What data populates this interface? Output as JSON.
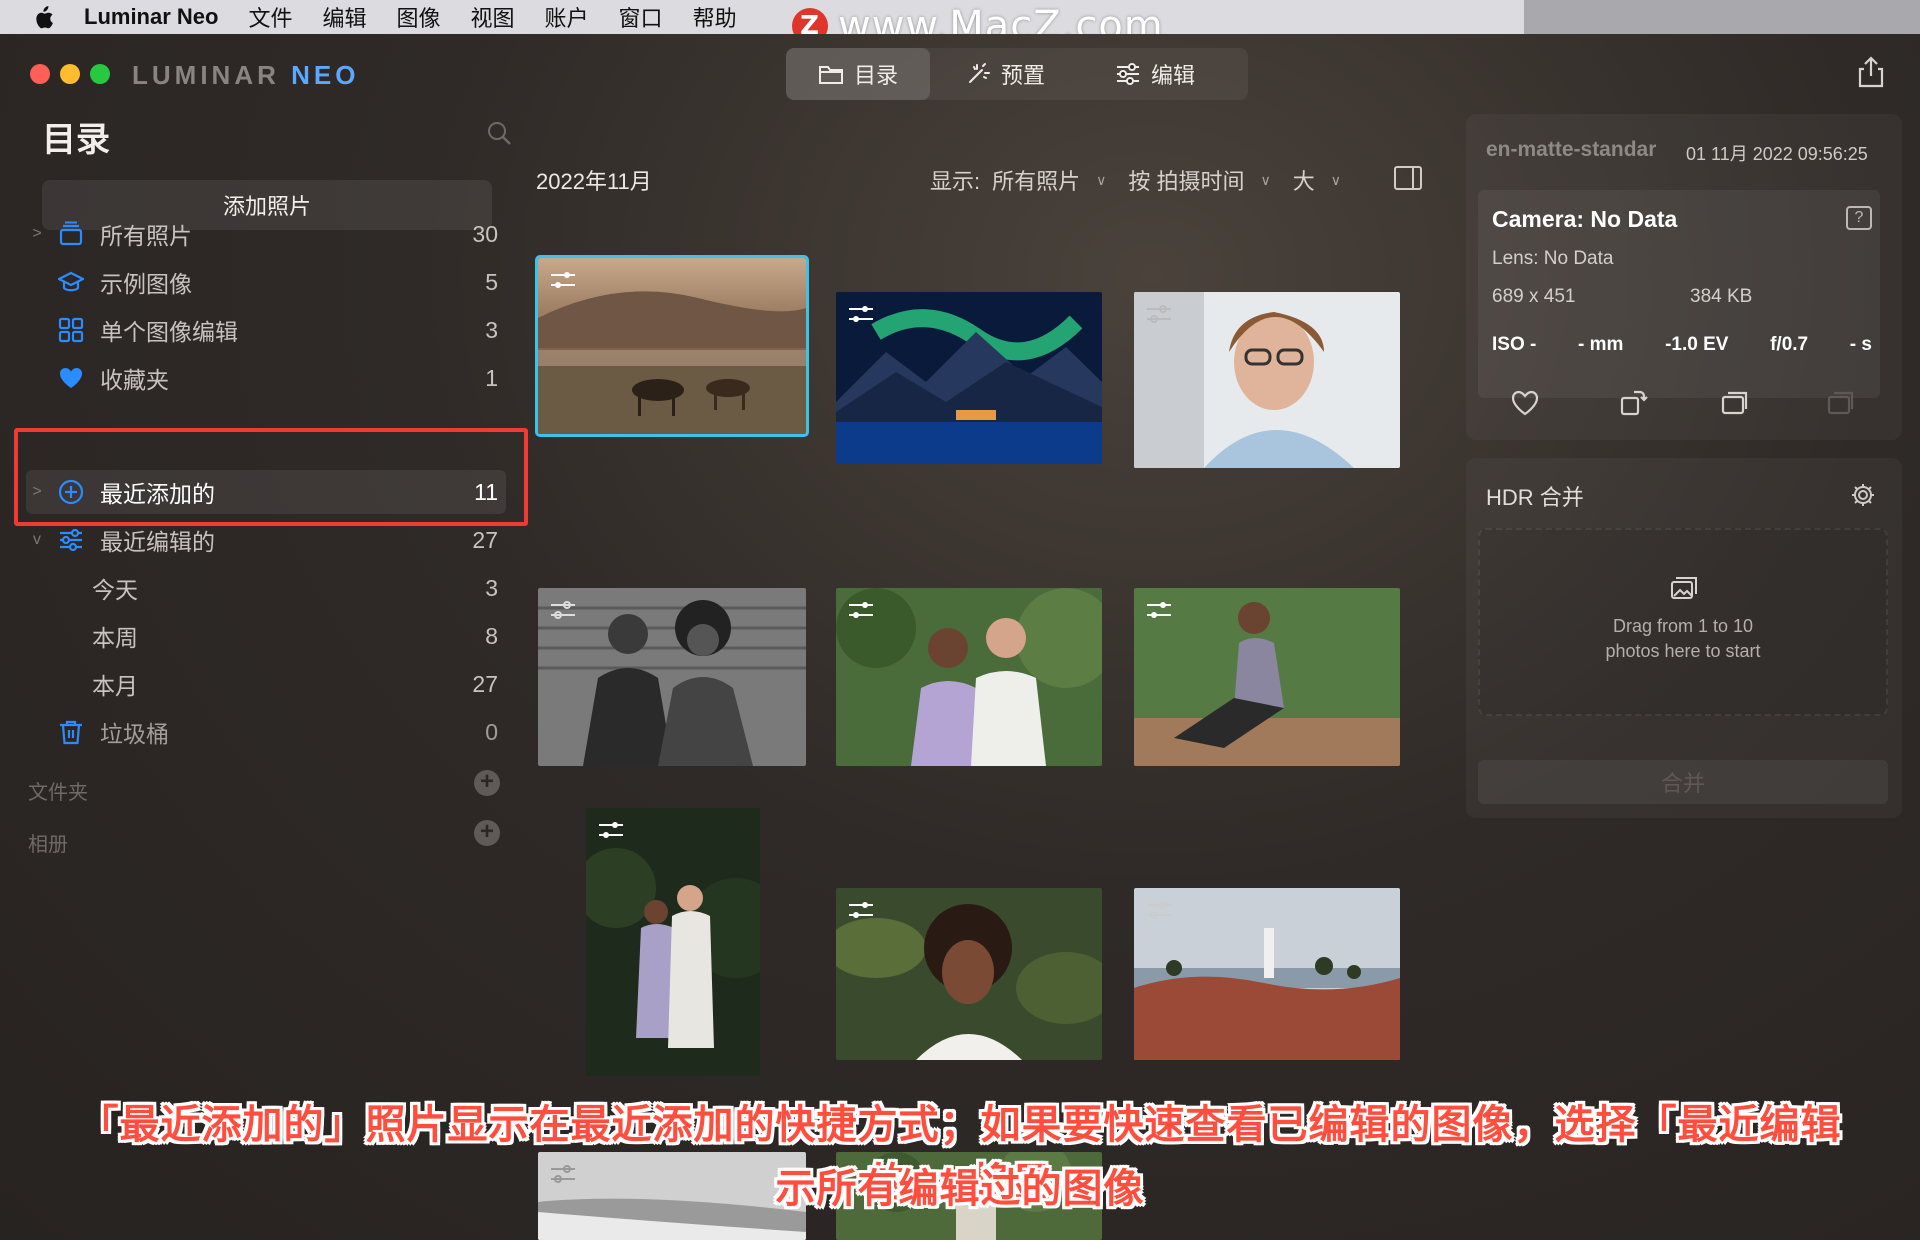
{
  "menubar": {
    "app_name": "Luminar Neo",
    "items": [
      "文件",
      "编辑",
      "图像",
      "视图",
      "账户",
      "窗口",
      "帮助"
    ]
  },
  "watermark": {
    "badge": "Z",
    "text": "www.MacZ.com"
  },
  "brand": {
    "left": "LUMINAR ",
    "right": "NEO"
  },
  "mode_tabs": [
    {
      "label": "目录",
      "icon": "folder-icon",
      "active": true
    },
    {
      "label": "预置",
      "icon": "sparkle-icon",
      "active": false
    },
    {
      "label": "编辑",
      "icon": "sliders-icon",
      "active": false
    }
  ],
  "sidebar": {
    "title": "目录",
    "add_button": "添加照片",
    "items": [
      {
        "label": "所有照片",
        "count": "30",
        "icon": "photos-stack-icon",
        "chevron": ">"
      },
      {
        "label": "示例图像",
        "count": "5",
        "icon": "graduation-cap-icon",
        "chevron": ""
      },
      {
        "label": "单个图像编辑",
        "count": "3",
        "icon": "grid-icon",
        "chevron": ""
      },
      {
        "label": "收藏夹",
        "count": "1",
        "icon": "heart-icon",
        "chevron": ""
      },
      {
        "label": "最近添加的",
        "count": "11",
        "icon": "plus-circle-icon",
        "chevron": ">"
      },
      {
        "label": "最近编辑的",
        "count": "27",
        "icon": "sliders-icon",
        "chevron": "v"
      },
      {
        "label": "今天",
        "count": "3"
      },
      {
        "label": "本周",
        "count": "8"
      },
      {
        "label": "本月",
        "count": "27"
      },
      {
        "label": "垃圾桶",
        "count": "0",
        "icon": "trash-icon",
        "chevron": ""
      }
    ],
    "sections": [
      "文件夹",
      "相册"
    ]
  },
  "grid": {
    "title": "2022年11月",
    "show_label": "显示:",
    "show_value": "所有照片",
    "sort_value": "按 拍摄时间",
    "size_value": "大"
  },
  "info": {
    "filename": "en-matte-standard",
    "date": "01 11月 2022 09:56:25",
    "camera": "Camera: No Data",
    "help": "?",
    "lens": "Lens: No Data",
    "dimensions": "689 x 451",
    "filesize": "384 KB",
    "exif": [
      "ISO -",
      "- mm",
      "-1.0 EV",
      "f/0.7",
      "- s"
    ]
  },
  "hdr": {
    "title": "HDR 合并",
    "drop_line1": "Drag from 1 to 10",
    "drop_line2": "photos here to start",
    "merge_button": "合并"
  },
  "caption": {
    "line1": "「最近添加的」照片显示在最近添加的快捷方式；如果要快速查看已编辑的图像，选择「最近编辑的」，将显",
    "line2": "示所有编辑过的图像"
  },
  "colors": {
    "accent": "#3fc2e8",
    "highlight": "#ef3b33",
    "icon_blue": "#2a8cff",
    "caption": "#ff4e3e"
  }
}
